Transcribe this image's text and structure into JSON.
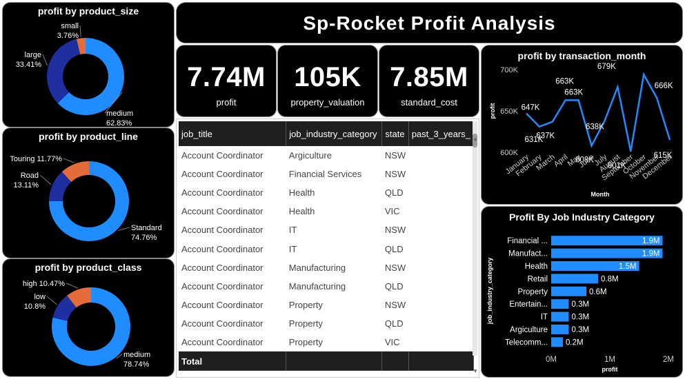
{
  "title": "Sp-Rocket Profit Analysis",
  "kpis": [
    {
      "value": "7.74M",
      "label": "profit"
    },
    {
      "value": "105K",
      "label": "property_valuation"
    },
    {
      "value": "7.85M",
      "label": "standard_cost"
    }
  ],
  "table": {
    "columns": [
      "job_title",
      "job_industry_category",
      "state",
      "past_3_years_"
    ],
    "rows": [
      [
        "Account Coordinator",
        "Argiculture",
        "NSW",
        ""
      ],
      [
        "Account Coordinator",
        "Financial Services",
        "NSW",
        ""
      ],
      [
        "Account Coordinator",
        "Health",
        "QLD",
        ""
      ],
      [
        "Account Coordinator",
        "Health",
        "VIC",
        ""
      ],
      [
        "Account Coordinator",
        "IT",
        "NSW",
        ""
      ],
      [
        "Account Coordinator",
        "IT",
        "QLD",
        ""
      ],
      [
        "Account Coordinator",
        "Manufacturing",
        "NSW",
        ""
      ],
      [
        "Account Coordinator",
        "Manufacturing",
        "QLD",
        ""
      ],
      [
        "Account Coordinator",
        "Property",
        "NSW",
        ""
      ],
      [
        "Account Coordinator",
        "Property",
        "QLD",
        ""
      ],
      [
        "Account Coordinator",
        "Property",
        "VIC",
        ""
      ]
    ],
    "total_label": "Total"
  },
  "colors": {
    "dark_blue": "#1f2fa0",
    "blue": "#1f8cff",
    "orange": "#e46b3a",
    "panel": "#000000"
  },
  "chart_data": [
    {
      "type": "pie",
      "title": "profit by product_size",
      "slices": [
        {
          "name": "medium",
          "value": 62.83,
          "label": "62.83%",
          "color": "#1f8cff"
        },
        {
          "name": "large",
          "value": 33.41,
          "label": "33.41%",
          "color": "#1f2fa0"
        },
        {
          "name": "small",
          "value": 3.76,
          "label": "3.76%",
          "color": "#e46b3a"
        }
      ]
    },
    {
      "type": "pie",
      "title": "profit by product_line",
      "slices": [
        {
          "name": "Standard",
          "value": 74.76,
          "label": "74.76%",
          "color": "#1f8cff"
        },
        {
          "name": "Road",
          "value": 13.11,
          "label": "13.11%",
          "color": "#1f2fa0"
        },
        {
          "name": "Touring",
          "value": 11.77,
          "label": "11.77%",
          "color": "#e46b3a"
        }
      ]
    },
    {
      "type": "pie",
      "title": "profit by product_class",
      "slices": [
        {
          "name": "medium",
          "value": 78.74,
          "label": "78.74%",
          "color": "#1f8cff"
        },
        {
          "name": "low",
          "value": 10.8,
          "label": "10.8%",
          "color": "#1f2fa0"
        },
        {
          "name": "high",
          "value": 10.47,
          "label": "10.47%",
          "color": "#e46b3a"
        }
      ]
    },
    {
      "type": "line",
      "title": "profit by transaction_month",
      "xlabel": "Month",
      "ylabel": "profit",
      "categories": [
        "January",
        "February",
        "March",
        "April",
        "May",
        "June",
        "July",
        "August",
        "September",
        "October",
        "November",
        "December"
      ],
      "values": [
        647,
        631,
        637,
        663,
        663,
        608,
        638,
        679,
        601,
        694,
        666,
        615
      ],
      "data_labels": [
        "647K",
        "631K",
        "637K",
        "663K",
        "663K",
        "608K",
        "638K",
        "679K",
        "601K",
        "694K",
        "666K",
        "615K"
      ],
      "yticks": [
        "600K",
        "650K",
        "700K"
      ],
      "ylim": [
        600,
        700
      ],
      "color": "#1f8cff"
    },
    {
      "type": "bar",
      "title": "Profit By Job Industry Category",
      "xlabel": "profit",
      "ylabel": "job_industry_category",
      "categories": [
        "Financial ...",
        "Manufact...",
        "Health",
        "Retail",
        "Property",
        "Entertain...",
        "IT",
        "Argiculture",
        "Telecomm..."
      ],
      "values": [
        1.9,
        1.9,
        1.5,
        0.8,
        0.6,
        0.3,
        0.3,
        0.3,
        0.2
      ],
      "data_labels": [
        "1.9M",
        "1.9M",
        "1.5M",
        "0.8M",
        "0.6M",
        "0.3M",
        "0.3M",
        "0.3M",
        "0.2M"
      ],
      "xticks": [
        "0M",
        "1M",
        "2M"
      ],
      "xlim": [
        0,
        2
      ],
      "color": "#1f8cff"
    }
  ]
}
